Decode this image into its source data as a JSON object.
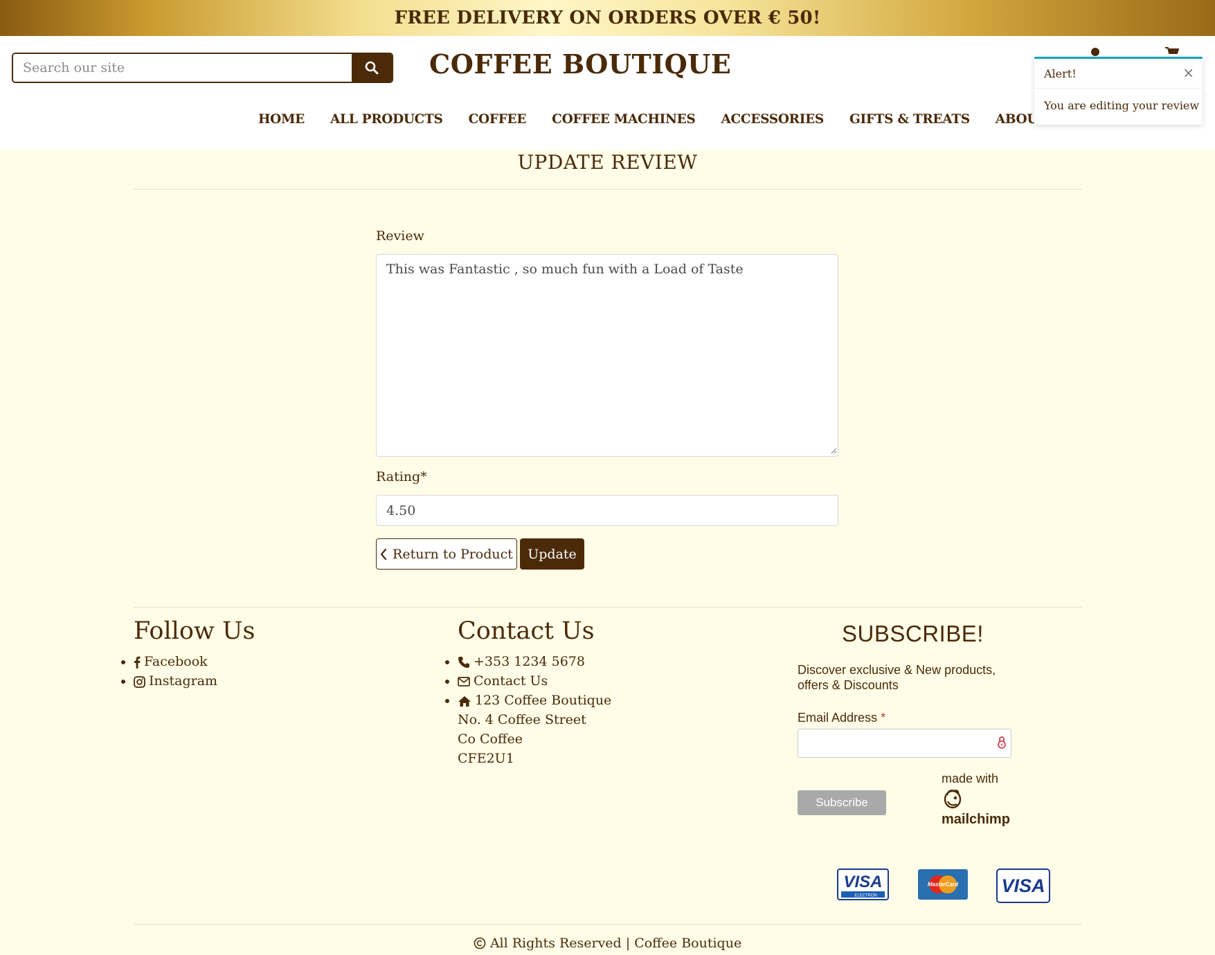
{
  "banner": {
    "text": "FREE DELIVERY ON ORDERS OVER € 50!"
  },
  "header": {
    "search_placeholder": "Search our site",
    "logo": "COFFEE BOUTIQUE"
  },
  "nav": {
    "items": [
      "HOME",
      "ALL PRODUCTS",
      "COFFEE",
      "COFFEE MACHINES",
      "ACCESSORIES",
      "GIFTS & TREATS",
      "ABOUT"
    ]
  },
  "toast": {
    "title": "Alert!",
    "close": "×",
    "message": "You are editing your review"
  },
  "page": {
    "title": "UPDATE REVIEW"
  },
  "form": {
    "review_label": "Review",
    "review_value": "This was Fantastic , so much fun with a Load of Taste",
    "rating_label": "Rating*",
    "rating_value": "4.50",
    "return_label": "Return to Product",
    "update_label": "Update"
  },
  "footer": {
    "follow": {
      "heading": "Follow Us",
      "items": [
        "Facebook",
        "Instagram"
      ]
    },
    "contact": {
      "heading": "Contact Us",
      "phone": "+353 1234 5678",
      "contact_link": "Contact Us",
      "address_line1": "123 Coffee Boutique",
      "address_line2": "No. 4 Coffee Street",
      "address_line3": "Co Coffee",
      "address_line4": "CFE2U1"
    },
    "subscribe": {
      "heading": "SUBSCRIBE!",
      "description": "Discover exclusive & New products, offers & Discounts",
      "email_label": "Email Address",
      "required_mark": "*",
      "button": "Subscribe",
      "made_with": "made with",
      "brand": "mailchimp"
    },
    "payment_cards": [
      "VISA",
      "MasterCard",
      "VISA"
    ],
    "card_sub": "ELECTRON",
    "copyright": "All Rights Reserved | Coffee Boutique"
  },
  "colors": {
    "brand": "#4a2a08",
    "background": "#fffde8",
    "toast_accent": "#17a2b8"
  }
}
